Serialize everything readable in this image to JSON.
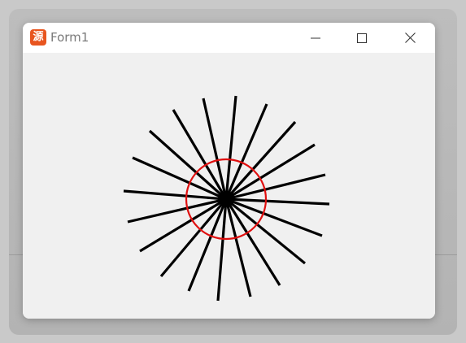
{
  "window": {
    "title": "Form1",
    "icon": "delphi-app-icon",
    "icon_glyph": "源",
    "controls": {
      "minimize_icon": "minimize-icon",
      "maximize_icon": "maximize-icon",
      "close_icon": "close-icon"
    }
  },
  "canvas": {
    "spoke_count": 20,
    "spoke_color": "#000000",
    "circle_color": "#e01010",
    "background": "#f0f0f0"
  }
}
